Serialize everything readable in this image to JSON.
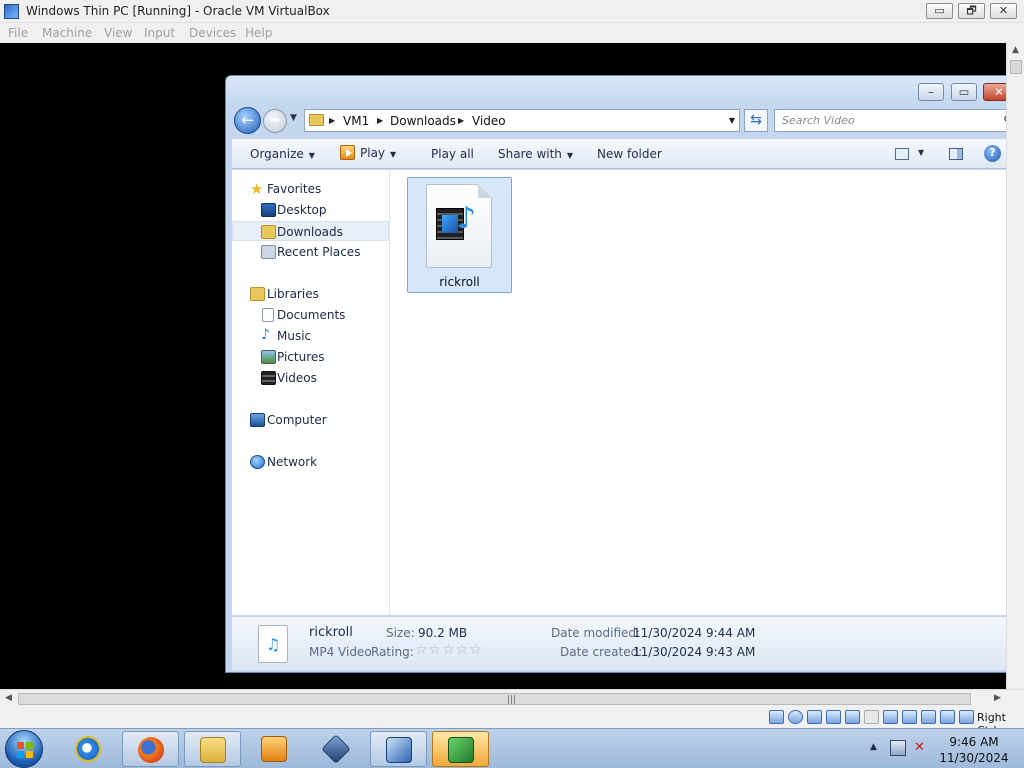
{
  "host": {
    "title": "Windows Thin PC [Running] - Oracle VM VirtualBox",
    "controls": {
      "minimize": "▭",
      "restore": "🗗",
      "close": "✕"
    },
    "menu": [
      "File",
      "Machine",
      "View",
      "Input",
      "Devices",
      "Help"
    ],
    "hscroll_grip": "|||",
    "host_key_label": "Right Ctrl"
  },
  "explorer": {
    "breadcrumb": [
      "VM1",
      "Downloads",
      "Video"
    ],
    "search_placeholder": "Search Video",
    "toolbar": {
      "organize": "Organize",
      "play": "Play",
      "play_all": "Play all",
      "share_with": "Share with",
      "new_folder": "New folder",
      "help": "?"
    },
    "nav_pane": {
      "favorites": "Favorites",
      "desktop": "Desktop",
      "downloads": "Downloads",
      "recent_places": "Recent Places",
      "libraries": "Libraries",
      "documents": "Documents",
      "music": "Music",
      "pictures": "Pictures",
      "videos": "Videos",
      "computer": "Computer",
      "network": "Network"
    },
    "files": [
      {
        "name": "rickroll"
      }
    ],
    "details": {
      "name": "rickroll",
      "type": "MP4 Video",
      "size_label": "Size:",
      "size": "90.2 MB",
      "rating_label": "Rating:",
      "rating_stars": "☆☆☆☆☆",
      "modified_label": "Date modified:",
      "modified": "11/30/2024 9:44 AM",
      "created_label": "Date created:",
      "created": "11/30/2024 9:43 AM"
    }
  },
  "taskbar": {
    "time": "9:46 AM",
    "date": "11/30/2024",
    "items": [
      "internet-explorer-icon",
      "firefox-icon",
      "file-explorer-icon",
      "media-player-icon",
      "virtualbox-icon",
      "w7-installer-icon",
      "security-icon"
    ]
  },
  "colors": {
    "accent": "#1e5fb6",
    "selection": "#d6e7fa",
    "taskbar": "#9eb9da"
  }
}
